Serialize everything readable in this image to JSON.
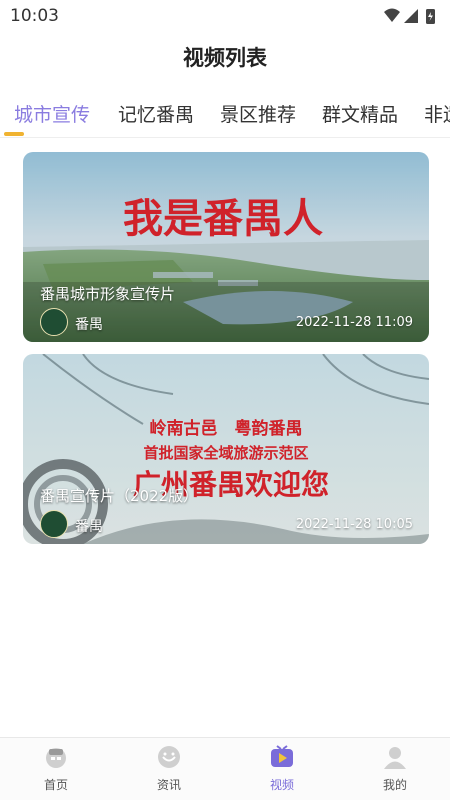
{
  "status_bar": {
    "time": "10:03"
  },
  "header": {
    "title": "视频列表"
  },
  "tabs": [
    {
      "label": "城市宣传",
      "active": true
    },
    {
      "label": "记忆番禺",
      "active": false
    },
    {
      "label": "景区推荐",
      "active": false
    },
    {
      "label": "群文精品",
      "active": false
    },
    {
      "label": "非遗",
      "active": false
    }
  ],
  "videos": [
    {
      "title": "番禺城市形象宣传片",
      "author": "番禺",
      "date": "2022-11-28 11:09",
      "thumb_text": "我是番禺人"
    },
    {
      "title": "番禺宣传片（2022版）",
      "author": "番禺",
      "date": "2022-11-28 10:05",
      "thumb_lines": [
        "岭南古邑　粤韵番禺",
        "首批国家全域旅游示范区",
        "广州番禺欢迎您"
      ]
    }
  ],
  "bottom_nav": [
    {
      "label": "首页",
      "icon": "home-icon",
      "active": false
    },
    {
      "label": "资讯",
      "icon": "news-icon",
      "active": false
    },
    {
      "label": "视频",
      "icon": "video-icon",
      "active": true
    },
    {
      "label": "我的",
      "icon": "profile-icon",
      "active": false
    }
  ],
  "colors": {
    "accent": "#8a7ce0",
    "indicator": "#f0b331",
    "thumb_red": "#d0222a"
  }
}
